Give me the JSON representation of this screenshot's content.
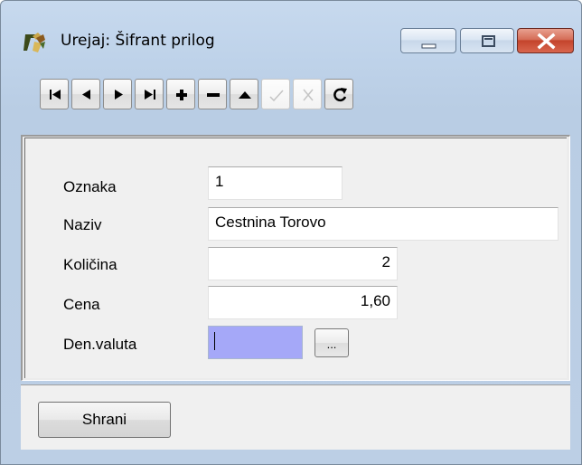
{
  "window": {
    "title": "Urejaj: Šifrant prilog",
    "app_icon": "app-logo-icon",
    "caption_buttons": [
      "minimize-icon",
      "maximize-icon",
      "close-icon"
    ]
  },
  "toolbar": {
    "buttons": [
      {
        "name": "first-record",
        "icon": "skip-first-icon",
        "enabled": true
      },
      {
        "name": "prior-record",
        "icon": "prev-icon",
        "enabled": true
      },
      {
        "name": "next-record",
        "icon": "next-icon",
        "enabled": true
      },
      {
        "name": "last-record",
        "icon": "skip-last-icon",
        "enabled": true
      },
      {
        "name": "insert-record",
        "icon": "plus-icon",
        "enabled": true
      },
      {
        "name": "delete-record",
        "icon": "minus-icon",
        "enabled": true
      },
      {
        "name": "edit-record",
        "icon": "triangle-up-icon",
        "enabled": true
      },
      {
        "name": "post-record",
        "icon": "checkmark-icon",
        "enabled": false
      },
      {
        "name": "cancel-record",
        "icon": "x-icon",
        "enabled": false
      },
      {
        "name": "refresh-records",
        "icon": "refresh-icon",
        "enabled": true
      }
    ]
  },
  "form": {
    "oznaka": {
      "label": "Oznaka",
      "value": "1"
    },
    "naziv": {
      "label": "Naziv",
      "value": "Cestnina Torovo"
    },
    "kolicina": {
      "label": "Količina",
      "value": "2"
    },
    "cena": {
      "label": "Cena",
      "value": "1,60"
    },
    "den_valuta": {
      "label": "Den.valuta",
      "value": "",
      "browse_label": "..."
    }
  },
  "footer": {
    "save_label": "Shrani"
  },
  "colors": {
    "active_field": "#a5a8f8",
    "close_button": "#c4442c"
  }
}
